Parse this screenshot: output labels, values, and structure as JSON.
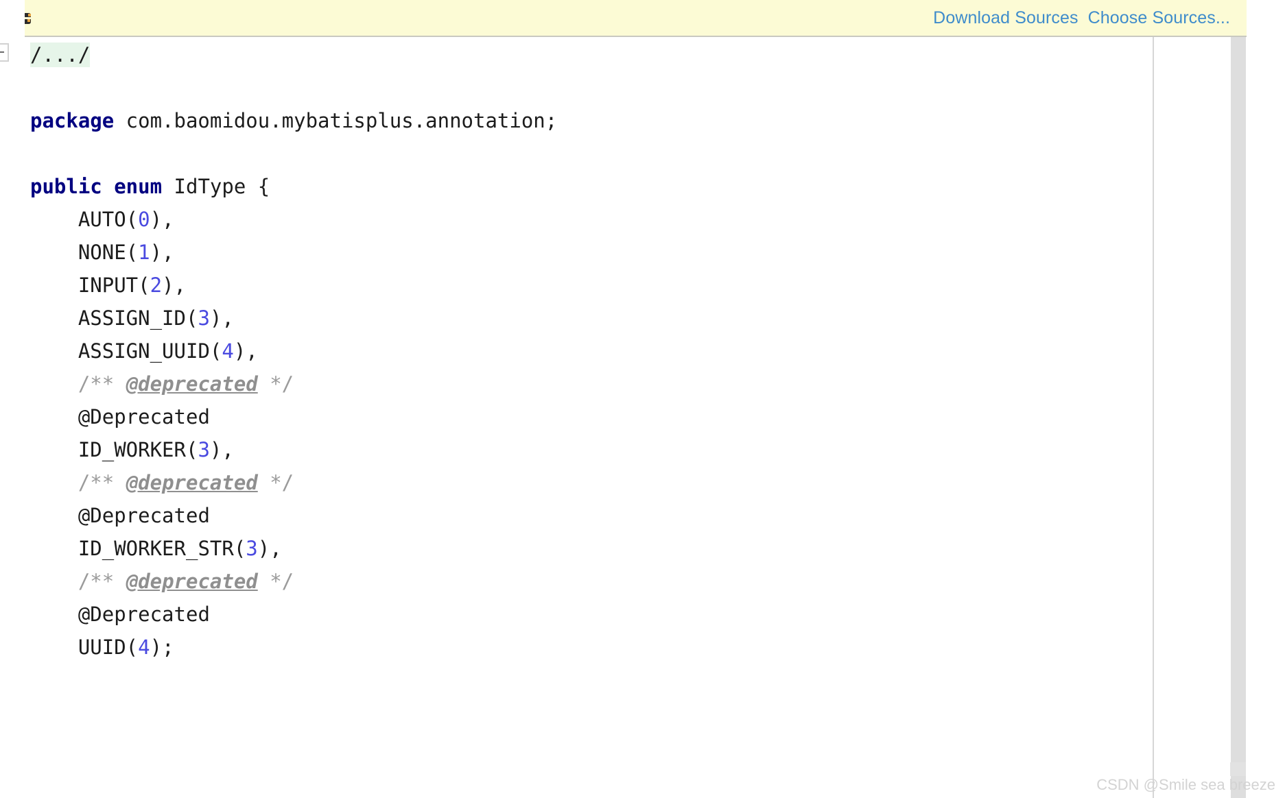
{
  "notification_bar": {
    "icon": "attached-source-icon",
    "links": [
      {
        "name": "download-sources-link",
        "label": "Download Sources"
      },
      {
        "name": "choose-sources-link",
        "label": "Choose Sources..."
      }
    ],
    "background_color": "#fcfbd5",
    "link_color": "#3f8ccb"
  },
  "gutter": {
    "fold_marker": "collapse-minus-icon"
  },
  "editor": {
    "language": "java",
    "folded_comment": "/.../",
    "colors": {
      "keyword": "#000080",
      "number": "#4a4ae0",
      "comment": "#9b9b9b",
      "text": "#1c1c1c",
      "folded_background": "#e6f5e9"
    },
    "lines": [
      {
        "indent": 0,
        "tokens": []
      },
      {
        "indent": 0,
        "tokens": [
          {
            "t": "kw",
            "v": "package"
          },
          {
            "t": "plain",
            "v": " com.baomidou.mybatisplus.annotation;"
          }
        ]
      },
      {
        "indent": 0,
        "tokens": []
      },
      {
        "indent": 0,
        "tokens": [
          {
            "t": "kw",
            "v": "public enum"
          },
          {
            "t": "plain",
            "v": " IdType {"
          }
        ]
      },
      {
        "indent": 1,
        "tokens": [
          {
            "t": "plain",
            "v": "AUTO("
          },
          {
            "t": "num",
            "v": "0"
          },
          {
            "t": "plain",
            "v": "),"
          }
        ]
      },
      {
        "indent": 1,
        "tokens": [
          {
            "t": "plain",
            "v": "NONE("
          },
          {
            "t": "num",
            "v": "1"
          },
          {
            "t": "plain",
            "v": "),"
          }
        ]
      },
      {
        "indent": 1,
        "tokens": [
          {
            "t": "plain",
            "v": "INPUT("
          },
          {
            "t": "num",
            "v": "2"
          },
          {
            "t": "plain",
            "v": "),"
          }
        ]
      },
      {
        "indent": 1,
        "tokens": [
          {
            "t": "plain",
            "v": "ASSIGN_ID("
          },
          {
            "t": "num",
            "v": "3"
          },
          {
            "t": "plain",
            "v": "),"
          }
        ]
      },
      {
        "indent": 1,
        "tokens": [
          {
            "t": "plain",
            "v": "ASSIGN_UUID("
          },
          {
            "t": "num",
            "v": "4"
          },
          {
            "t": "plain",
            "v": "),"
          }
        ]
      },
      {
        "indent": 1,
        "tokens": [
          {
            "t": "comment",
            "v": "/** "
          },
          {
            "t": "jdoc",
            "v": "@deprecated"
          },
          {
            "t": "comment",
            "v": " */"
          }
        ]
      },
      {
        "indent": 1,
        "tokens": [
          {
            "t": "plain",
            "v": "@Deprecated"
          }
        ]
      },
      {
        "indent": 1,
        "tokens": [
          {
            "t": "plain",
            "v": "ID_WORKER("
          },
          {
            "t": "num",
            "v": "3"
          },
          {
            "t": "plain",
            "v": "),"
          }
        ]
      },
      {
        "indent": 1,
        "tokens": [
          {
            "t": "comment",
            "v": "/** "
          },
          {
            "t": "jdoc",
            "v": "@deprecated"
          },
          {
            "t": "comment",
            "v": " */"
          }
        ]
      },
      {
        "indent": 1,
        "tokens": [
          {
            "t": "plain",
            "v": "@Deprecated"
          }
        ]
      },
      {
        "indent": 1,
        "tokens": [
          {
            "t": "plain",
            "v": "ID_WORKER_STR("
          },
          {
            "t": "num",
            "v": "3"
          },
          {
            "t": "plain",
            "v": "),"
          }
        ]
      },
      {
        "indent": 1,
        "tokens": [
          {
            "t": "comment",
            "v": "/** "
          },
          {
            "t": "jdoc",
            "v": "@deprecated"
          },
          {
            "t": "comment",
            "v": " */"
          }
        ]
      },
      {
        "indent": 1,
        "tokens": [
          {
            "t": "plain",
            "v": "@Deprecated"
          }
        ]
      },
      {
        "indent": 1,
        "tokens": [
          {
            "t": "plain",
            "v": "UUID("
          },
          {
            "t": "num",
            "v": "4"
          },
          {
            "t": "plain",
            "v": ");"
          }
        ]
      }
    ]
  },
  "watermark": {
    "text": "CSDN @Smile sea breeze"
  }
}
